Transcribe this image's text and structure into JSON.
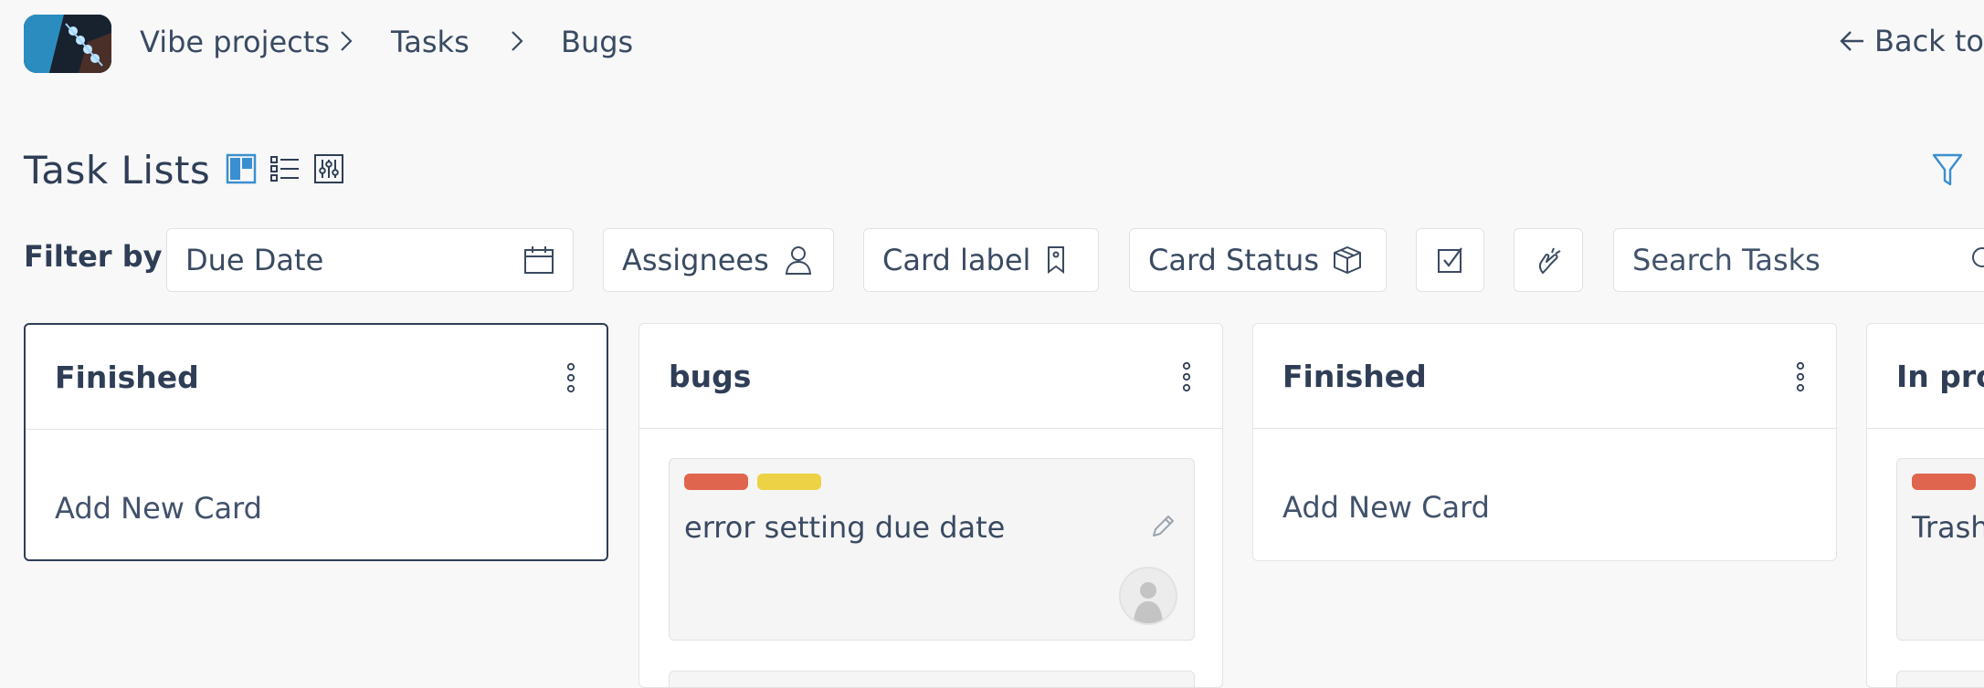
{
  "breadcrumb": {
    "items": [
      "Vibe projects",
      "Tasks",
      "Bugs"
    ],
    "back_label": "Back to"
  },
  "page": {
    "title": "Task Lists"
  },
  "filters": {
    "label": "Filter by",
    "due_date": "Due Date",
    "assignees": "Assignees",
    "card_label": "Card label",
    "card_status": "Card Status",
    "search_placeholder": "Search Tasks"
  },
  "columns": [
    {
      "title": "Finished",
      "add_card": "Add New Card"
    },
    {
      "title": "bugs",
      "card": {
        "title": "error setting due date",
        "labels": [
          "#e0654f",
          "#ecd244"
        ]
      }
    },
    {
      "title": "Finished",
      "add_card": "Add New Card"
    },
    {
      "title": "In progress",
      "card": {
        "title": "Trash",
        "labels": [
          "#e0654f"
        ]
      }
    }
  ],
  "colors": {
    "accent": "#3a8fd0",
    "text": "#2f3e56",
    "label_red": "#e0654f",
    "label_yellow": "#ecd244"
  }
}
